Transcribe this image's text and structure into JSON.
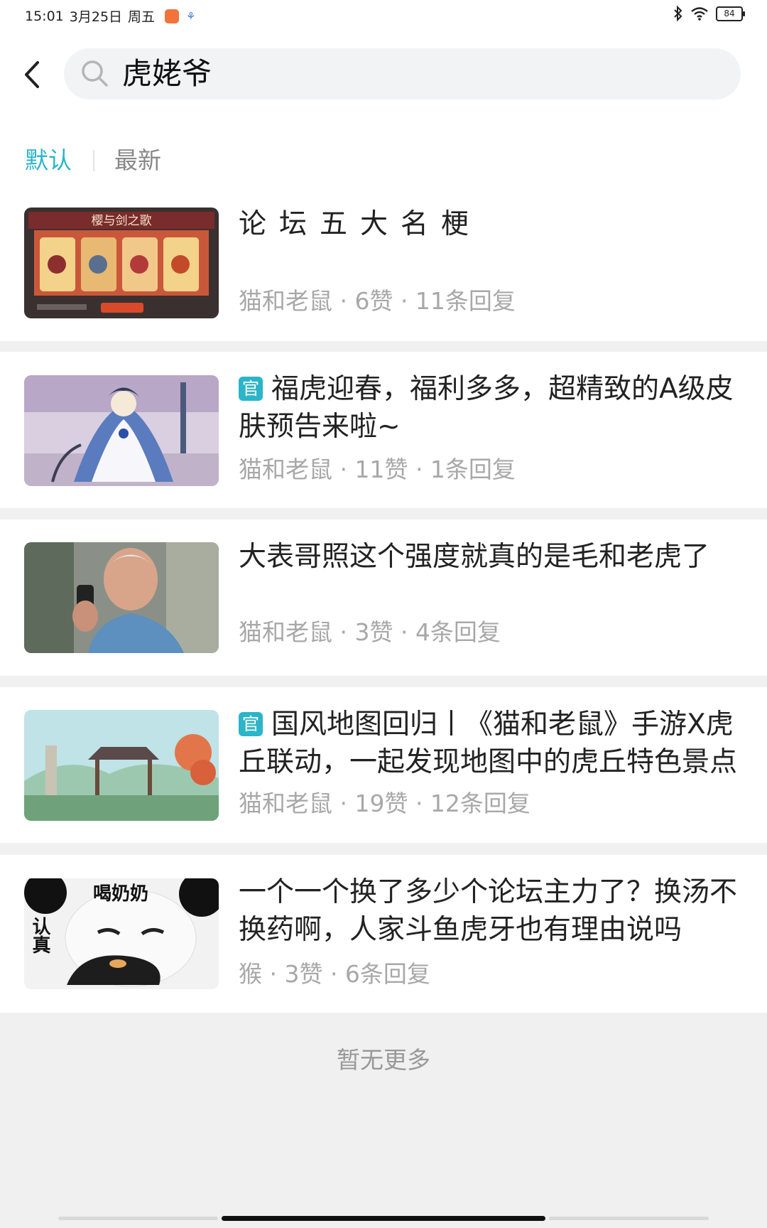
{
  "status_bar": {
    "time": "15:01",
    "date": "3月25日",
    "weekday": "周五",
    "battery": "84",
    "icons": [
      "app-notification-icon",
      "app-notification-icon-2",
      "bluetooth-icon",
      "wifi-icon",
      "battery-icon"
    ]
  },
  "header": {
    "back_icon": "chevron-left-icon",
    "search_icon": "search-icon",
    "search_query": "虎姥爷"
  },
  "tabs": [
    {
      "label": "默认",
      "active": true
    },
    {
      "label": "最新",
      "active": false
    }
  ],
  "posts": [
    {
      "title": "论坛五大名梗",
      "official": false,
      "meta": "猫和老鼠 · 6赞 · 11条回复",
      "thumb_caption": "樱与剑之歌"
    },
    {
      "title": "福虎迎春，福利多多，超精致的A级皮肤预告来啦~",
      "official": true,
      "meta": "猫和老鼠 · 11赞 · 1条回复"
    },
    {
      "title": "大表哥照这个强度就真的是毛和老虎了",
      "official": false,
      "meta": "猫和老鼠 · 3赞 · 4条回复"
    },
    {
      "title": "国风地图回归丨《猫和老鼠》手游X虎丘联动，一起发现地图中的虎丘特色景点",
      "official": true,
      "meta": "猫和老鼠 · 19赞 · 12条回复"
    },
    {
      "title": "一个一个换了多少个论坛主力了？换汤不换药啊，人家斗鱼虎牙也有理由说吗",
      "official": false,
      "meta": "猴 · 3赞 · 6条回复",
      "thumb_caption": "喝奶奶",
      "thumb_caption_2": "认真"
    }
  ],
  "official_badge": "官",
  "footer": {
    "no_more": "暂无更多"
  },
  "colors": {
    "accent": "#2ab5c9",
    "meta_text": "#a8a8a8",
    "separator": "#f0f0f0"
  }
}
